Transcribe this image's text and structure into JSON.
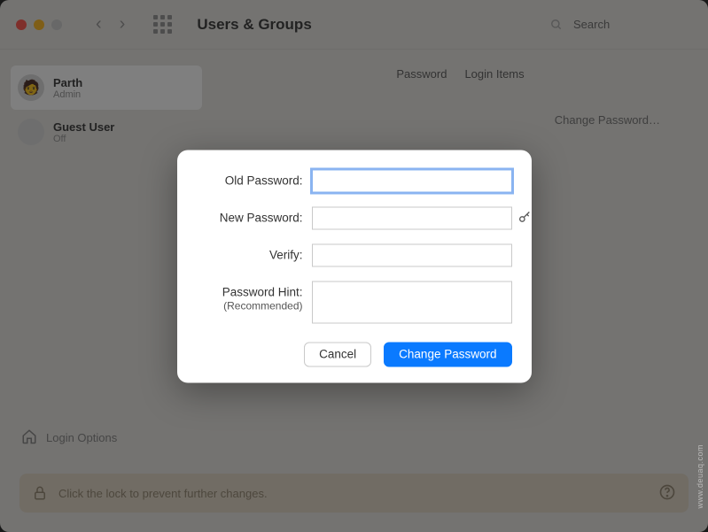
{
  "window": {
    "title": "Users & Groups",
    "search_placeholder": "Search"
  },
  "sidebar": {
    "users": [
      {
        "name": "Parth",
        "role": "Admin",
        "avatar_emoji": "🧑"
      },
      {
        "name": "Guest User",
        "role": "Off",
        "avatar_emoji": ""
      }
    ],
    "login_options_label": "Login Options"
  },
  "main": {
    "tabs": [
      "Password",
      "Login Items"
    ],
    "change_password_btn": "Change Password…"
  },
  "bottom_banner": {
    "text": "Click the lock to prevent further changes."
  },
  "dialog": {
    "old_password_label": "Old Password:",
    "new_password_label": "New Password:",
    "verify_label": "Verify:",
    "hint_label": "Password Hint:",
    "hint_sub": "(Recommended)",
    "fields": {
      "old_password": "",
      "new_password": "",
      "verify": "",
      "hint": ""
    },
    "cancel_label": "Cancel",
    "submit_label": "Change Password"
  },
  "watermark": "www.deuaq.com"
}
